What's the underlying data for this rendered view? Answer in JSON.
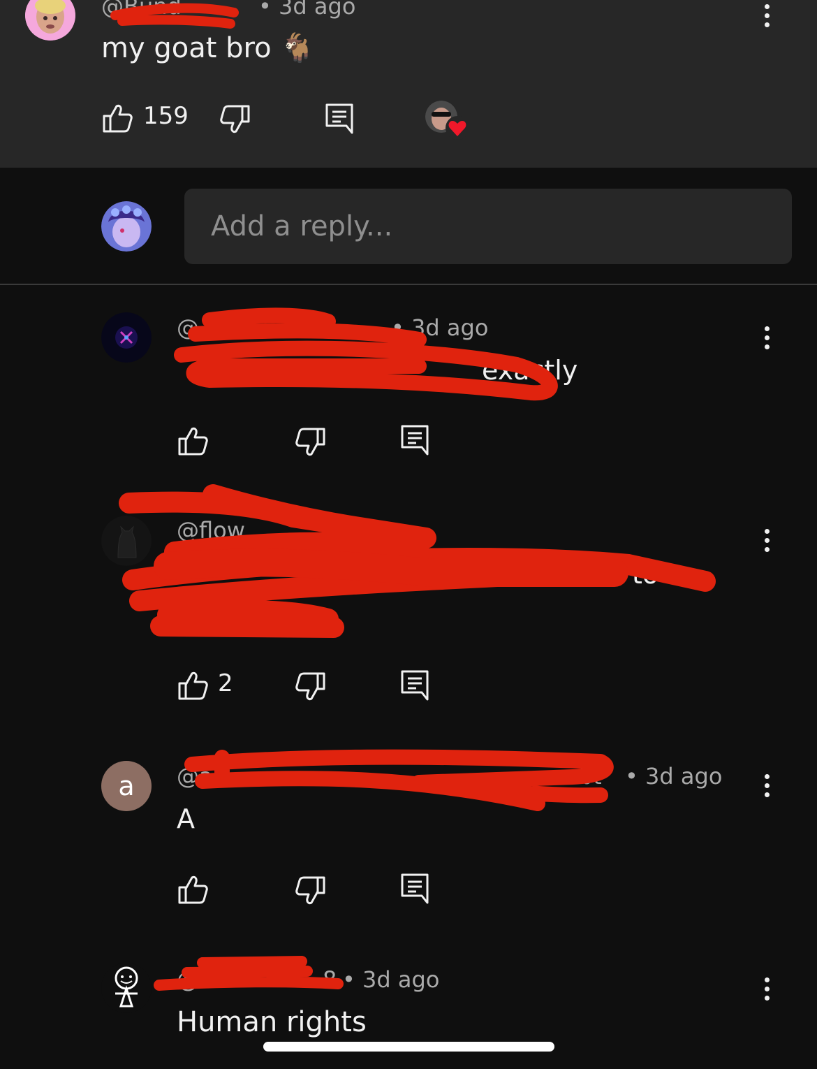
{
  "top_comment": {
    "author_visible": "@Bund",
    "time": "• 3d ago",
    "text": "my goat bro 🐐",
    "likes": "159"
  },
  "reply_box": {
    "placeholder": "Add a reply..."
  },
  "replies": [
    {
      "author_visible": "@",
      "time": "• 3d ago",
      "text": "exactly",
      "likes": ""
    },
    {
      "author_visible": "@flow",
      "time": "",
      "text": "to",
      "text2": "",
      "likes": "2"
    },
    {
      "avatar_letter": "a",
      "author_visible": "@a",
      "author_tail": "aaabt",
      "time": "• 3d ago",
      "text": "A",
      "likes": ""
    },
    {
      "author_visible": "@",
      "author_tail": "8",
      "time": "• 3d ago",
      "text": "Human rights"
    }
  ],
  "colors": {
    "background": "#0f0f0f",
    "highlight_bg": "#272727",
    "redaction": "#e0230e",
    "secondary_text": "#aaaaaa"
  }
}
